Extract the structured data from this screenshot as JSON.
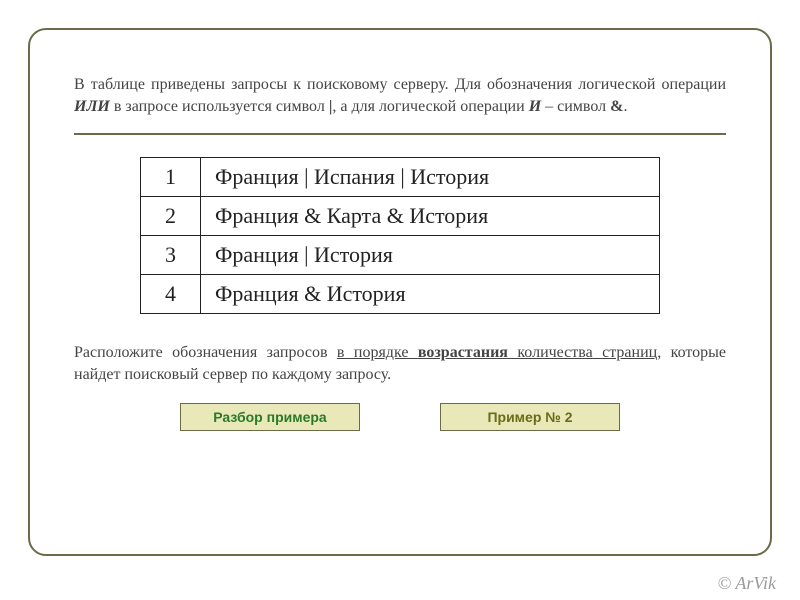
{
  "intro": {
    "part1": "В таблице приведены запросы к поисковому серверу. Для обозначения логической операции ",
    "ili": "ИЛИ",
    "part2": " в запросе используется символ ",
    "sym1": "|",
    "part3": ", а для логической операции ",
    "i": "И",
    "part4": " – символ ",
    "sym2": "&",
    "part5": "."
  },
  "rows": [
    {
      "n": "1",
      "q": "Франция | Испания | История"
    },
    {
      "n": "2",
      "q": "Франция & Карта & История"
    },
    {
      "n": "3",
      "q": "Франция | История"
    },
    {
      "n": "4",
      "q": "Франция & История"
    }
  ],
  "task": {
    "part1": "Расположите обозначения запросов ",
    "ul1": "в порядке ",
    "emph": "возрастания",
    "ul2": " количества страниц",
    "part2": ", которые найдет поисковый сервер по каждому запросу."
  },
  "buttons": {
    "left": "Разбор примера",
    "right": "Пример № 2"
  },
  "copyright": "© ArVik"
}
